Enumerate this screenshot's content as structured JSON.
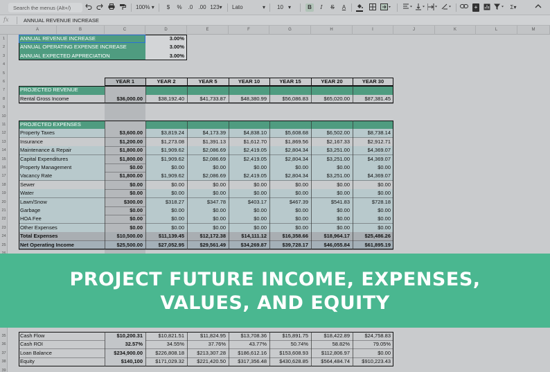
{
  "toolbar": {
    "search_placeholder": "Search the menus (Alt+/)",
    "zoom": "100%",
    "currency": "$",
    "percent": "%",
    "decrease_decimal": ".0",
    "increase_decimal": ".00",
    "number_format": "123",
    "font": "Lato",
    "font_size": "10",
    "bold": "B",
    "italic": "I",
    "strikethrough": "S",
    "text_color": "A",
    "insert_comment": "+",
    "function": "Σ"
  },
  "formula_bar": {
    "fx": "fx",
    "value": "ANNUAL REVENUE INCREASE"
  },
  "columns": [
    "A",
    "B",
    "C",
    "D",
    "E",
    "F",
    "G",
    "H",
    "I",
    "J",
    "K",
    "L",
    "M"
  ],
  "assumptions": [
    {
      "label": "ANNUAL REVENUE INCREASE",
      "value": "3.00%"
    },
    {
      "label": "ANNUAL OPERATING EXPENSE INCREASE",
      "value": "3.00%"
    },
    {
      "label": "ANNUAL EXPECTED APPRECIATION",
      "value": "3.00%"
    }
  ],
  "year_headers": [
    "YEAR 1",
    "YEAR 2",
    "YEAR 5",
    "YEAR 10",
    "YEAR 15",
    "YEAR 20",
    "YEAR 30"
  ],
  "sections": {
    "revenue": "PROJECTED REVENUE",
    "expenses": "PROJECTED EXPENSES"
  },
  "rows": [
    {
      "row": "8",
      "label": "Rental Gross Income",
      "values": [
        "$36,000.00",
        "$38,192.40",
        "$41,733.87",
        "$48,380.99",
        "$56,086.83",
        "$65,020.00",
        "$87,381.45"
      ]
    },
    {
      "row": "12",
      "label": "Property Taxes",
      "values": [
        "$3,600.00",
        "$3,819.24",
        "$4,173.39",
        "$4,838.10",
        "$5,608.68",
        "$6,502.00",
        "$8,738.14"
      ]
    },
    {
      "row": "13",
      "label": "Insurance",
      "values": [
        "$1,200.00",
        "$1,273.08",
        "$1,391.13",
        "$1,612.70",
        "$1,869.56",
        "$2,167.33",
        "$2,912.71"
      ]
    },
    {
      "row": "14",
      "label": "Maintenance & Repair",
      "values": [
        "$1,800.00",
        "$1,909.62",
        "$2,086.69",
        "$2,419.05",
        "$2,804.34",
        "$3,251.00",
        "$4,369.07"
      ]
    },
    {
      "row": "15",
      "label": "Capital Expenditures",
      "values": [
        "$1,800.00",
        "$1,909.62",
        "$2,086.69",
        "$2,419.05",
        "$2,804.34",
        "$3,251.00",
        "$4,369.07"
      ]
    },
    {
      "row": "16",
      "label": "Property Management",
      "values": [
        "$0.00",
        "$0.00",
        "$0.00",
        "$0.00",
        "$0.00",
        "$0.00",
        "$0.00"
      ]
    },
    {
      "row": "17",
      "label": "Vacancy Rate",
      "values": [
        "$1,800.00",
        "$1,909.62",
        "$2,086.69",
        "$2,419.05",
        "$2,804.34",
        "$3,251.00",
        "$4,369.07"
      ]
    },
    {
      "row": "18",
      "label": "Sewer",
      "values": [
        "$0.00",
        "$0.00",
        "$0.00",
        "$0.00",
        "$0.00",
        "$0.00",
        "$0.00"
      ]
    },
    {
      "row": "19",
      "label": "Water",
      "values": [
        "$0.00",
        "$0.00",
        "$0.00",
        "$0.00",
        "$0.00",
        "$0.00",
        "$0.00"
      ]
    },
    {
      "row": "20",
      "label": "Lawn/Snow",
      "values": [
        "$300.00",
        "$318.27",
        "$347.78",
        "$403.17",
        "$467.39",
        "$541.83",
        "$728.18"
      ]
    },
    {
      "row": "21",
      "label": "Garbage",
      "values": [
        "$0.00",
        "$0.00",
        "$0.00",
        "$0.00",
        "$0.00",
        "$0.00",
        "$0.00"
      ]
    },
    {
      "row": "22",
      "label": "HOA Fee",
      "values": [
        "$0.00",
        "$0.00",
        "$0.00",
        "$0.00",
        "$0.00",
        "$0.00",
        "$0.00"
      ]
    },
    {
      "row": "23",
      "label": "Other Expenses",
      "values": [
        "$0.00",
        "$0.00",
        "$0.00",
        "$0.00",
        "$0.00",
        "$0.00",
        "$0.00"
      ]
    },
    {
      "row": "24",
      "label": "Total Expenses",
      "values": [
        "$10,500.00",
        "$11,139.45",
        "$12,172.38",
        "$14,111.12",
        "$16,358.66",
        "$18,964.17",
        "$25,486.26"
      ]
    },
    {
      "row": "25",
      "label": "Net Operating Income",
      "values": [
        "$25,500.00",
        "$27,052.95",
        "$29,561.49",
        "$34,269.87",
        "$39,728.17",
        "$46,055.84",
        "$61,895.19"
      ]
    },
    {
      "row": "35",
      "label": "Cash Flow",
      "values": [
        "$10,200.31",
        "$10,821.51",
        "$11,824.95",
        "$13,708.36",
        "$15,891.75",
        "$18,422.89",
        "$24,758.83"
      ]
    },
    {
      "row": "36",
      "label": "Cash ROI",
      "values": [
        "32.57%",
        "34.55%",
        "37.76%",
        "43.77%",
        "50.74%",
        "58.82%",
        "79.05%"
      ]
    },
    {
      "row": "37",
      "label": "Loan Balance",
      "values": [
        "$234,900.00",
        "$226,808.18",
        "$213,307.28",
        "$186,612.16",
        "$153,608.93",
        "$112,806.97",
        "$0.00"
      ]
    },
    {
      "row": "38",
      "label": "Equity",
      "values": [
        "$140,100",
        "$171,029.32",
        "$221,420.50",
        "$317,356.48",
        "$430,628.85",
        "$564,484.74",
        "$910,223.43"
      ]
    }
  ],
  "row_numbers": [
    "1",
    "2",
    "3",
    "4",
    "5",
    "6",
    "7",
    "8",
    "9",
    "10",
    "11",
    "12",
    "13",
    "14",
    "15",
    "16",
    "17",
    "18",
    "19",
    "20",
    "21",
    "22",
    "23",
    "24",
    "25",
    "26",
    "35",
    "36",
    "37",
    "38",
    "39"
  ],
  "banner": {
    "line1": "PROJECT FUTURE INCOME, EXPENSES,",
    "line2": "VALUES, AND EQUITY"
  },
  "colors": {
    "banner": "#4ab790",
    "section_header": "#4f9c80",
    "stripe": "#b8c9cc",
    "total": "#a9aeb2",
    "year1_col": "#b5b8bb"
  }
}
